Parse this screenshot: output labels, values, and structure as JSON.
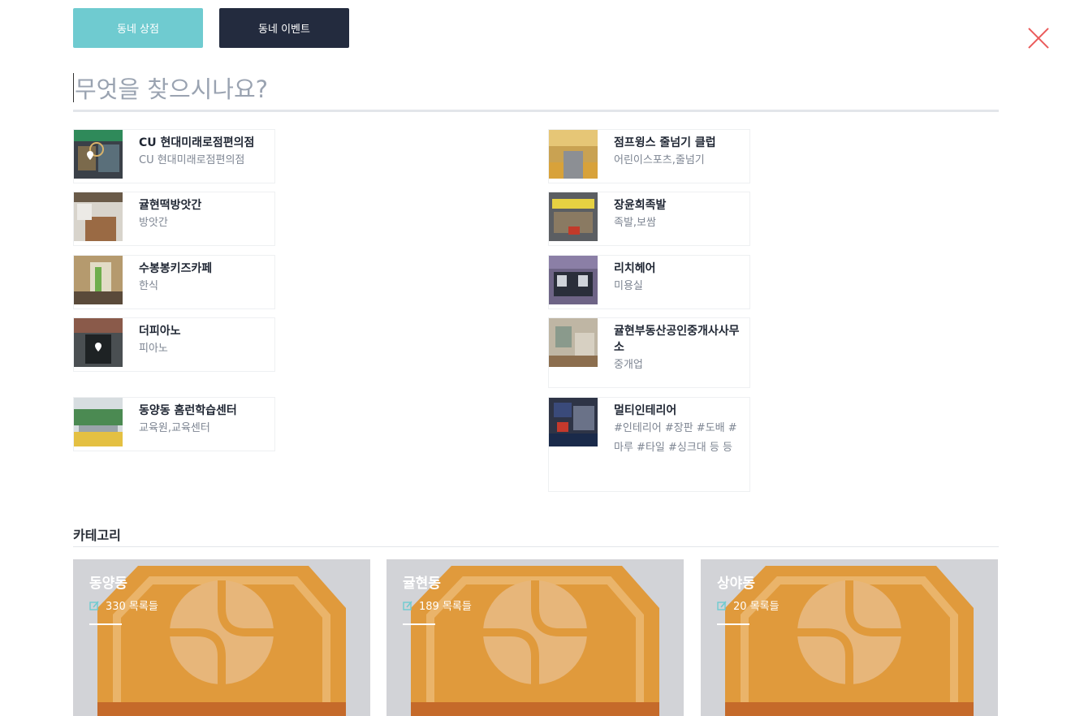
{
  "tabs": [
    {
      "label": "동네 상점"
    },
    {
      "label": "동네 이벤트"
    }
  ],
  "search": {
    "placeholder": "무엇을 찾으시나요?"
  },
  "results": {
    "left": [
      {
        "name": "CU 현대미래로점편의점",
        "sub": "CU 현대미래로점편의점"
      },
      {
        "name": "귤현떡방앗간",
        "sub": "방앗간"
      },
      {
        "name": "수봉봉키즈카페",
        "sub": "한식"
      },
      {
        "name": "더피아노",
        "sub": "피아노"
      },
      {
        "name": "동양동 홈런학습센터",
        "sub": "교육원,교육센터"
      }
    ],
    "right": [
      {
        "name": "점프윙스 줄넘기 클럽",
        "sub": "어린이스포츠,줄넘기"
      },
      {
        "name": "장윤희족발",
        "sub": "족발,보쌈"
      },
      {
        "name": "리치헤어",
        "sub": "미용실"
      },
      {
        "name": "귤현부동산공인중개사사무소",
        "sub": "중개업"
      },
      {
        "name": "멀티인테리어",
        "sub": "#인테리어 #장판 #도배 #마루 #타일 #싱크대 등 등"
      }
    ]
  },
  "category": {
    "title": "카테고리",
    "items": [
      {
        "name": "동양동",
        "count": "330 목록들"
      },
      {
        "name": "귤현동",
        "count": "189 목록들"
      },
      {
        "name": "상야동",
        "count": "20 목록들"
      }
    ]
  },
  "colors": {
    "accent": "#6fcbd0",
    "dark": "#232b3e",
    "close": "#ea5a5a",
    "badge": "#e09a3c"
  },
  "icons": {
    "close": "close-icon",
    "edit": "edit-icon",
    "pin": "map-pin-icon"
  }
}
